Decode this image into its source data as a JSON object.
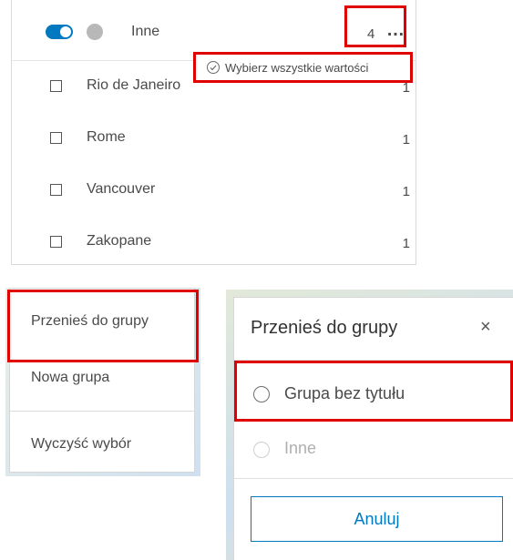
{
  "group": {
    "name": "Inne",
    "count": "4",
    "more_icon": "…",
    "select_all_label": "Wybierz wszystkie wartości"
  },
  "values": [
    {
      "label": "Rio de Janeiro",
      "count": "1"
    },
    {
      "label": "Rome",
      "count": "1"
    },
    {
      "label": "Vancouver",
      "count": "1"
    },
    {
      "label": "Zakopane",
      "count": "1"
    }
  ],
  "menu": {
    "move_to_group": "Przenieś do grupy",
    "new_group": "Nowa grupa",
    "clear_selection": "Wyczyść wybór"
  },
  "dialog": {
    "title": "Przenieś do grupy",
    "close_icon": "×",
    "options": [
      {
        "label": "Grupa bez tytułu",
        "enabled": true
      },
      {
        "label": "Inne",
        "enabled": false
      }
    ],
    "cancel_label": "Anuluj"
  },
  "colors": {
    "accent": "#0079c1",
    "highlight": "#e00000"
  }
}
